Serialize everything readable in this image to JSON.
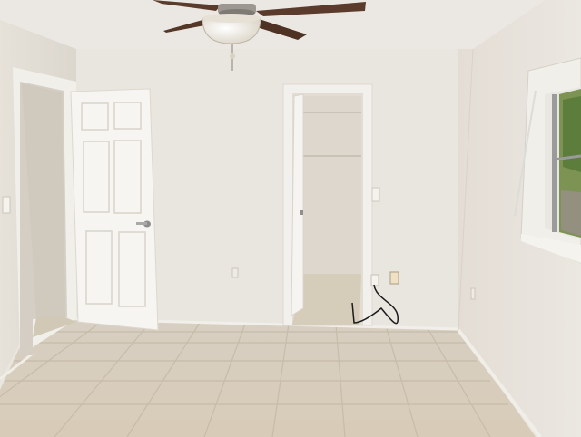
{
  "scene": {
    "subject": "empty-bedroom-interior",
    "elements": [
      "ceiling-fan",
      "open-six-panel-door",
      "walk-in-closet",
      "window",
      "tile-floor",
      "wall-outlet",
      "baseboard"
    ]
  },
  "colors": {
    "ceiling": "#ece9e4",
    "wall_main": "#e9e5df",
    "wall_left": "#e2ddd5",
    "wall_right": "#e6e1da",
    "floor": "#d9cfbf",
    "grout": "#c5bba9",
    "door": "#f7f6f2",
    "closet_interior": "#e3ddd3",
    "fan_blade": "#5a3a2c",
    "fan_globe": "#f3efe6",
    "window_green": "#6a8a46"
  }
}
